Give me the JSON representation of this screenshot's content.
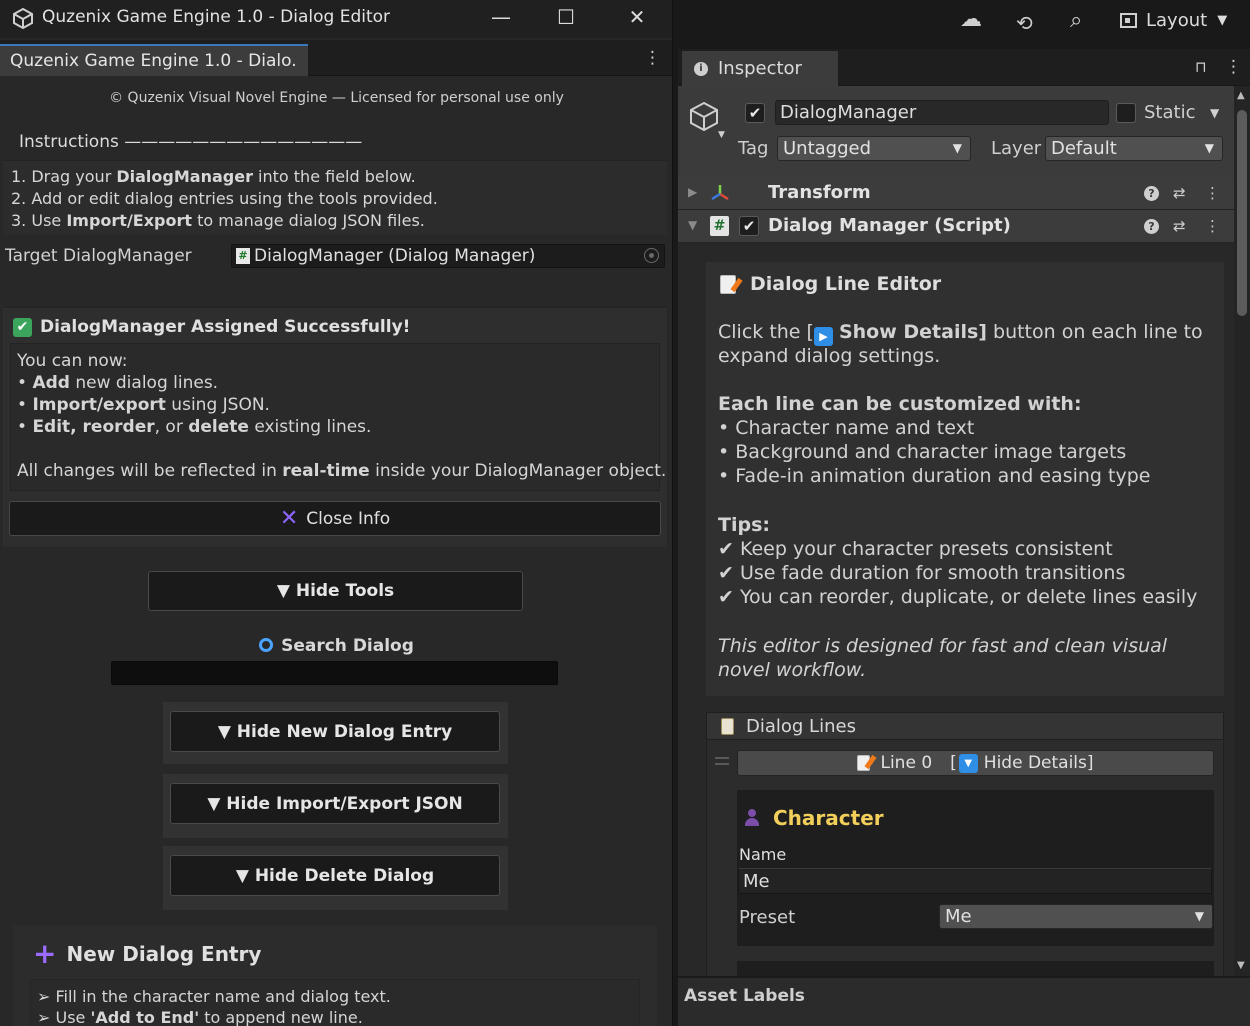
{
  "window": {
    "title": "Quzenix Game Engine 1.0 - Dialog Editor",
    "minimize": "—",
    "maximize": "☐",
    "close": "✕",
    "tab_label": "Quzenix Game Engine 1.0 - Dialo.",
    "tab_menu": "⋮"
  },
  "editor": {
    "copyright": "© Quzenix Visual Novel Engine — Licensed for personal use only",
    "instructions_heading": "Instructions ——————————————",
    "instructions": [
      {
        "pre": "1. Drag your ",
        "bold": "DialogManager",
        "post": " into the field below."
      },
      {
        "pre": "2. Add or edit dialog entries using the tools provided.",
        "bold": "",
        "post": ""
      },
      {
        "pre": "3. Use ",
        "bold": "Import/Export",
        "post": " to manage dialog JSON files."
      }
    ],
    "target_label": "Target DialogManager",
    "target_value": "DialogManager (Dialog Manager)",
    "success_title": "DialogManager Assigned Successfully!",
    "success_intro": "You can now:",
    "success_items": [
      {
        "bold": "Add",
        "post": " new dialog lines."
      },
      {
        "bold": "Import/export",
        "post": " using JSON."
      }
    ],
    "success_item3": {
      "b1": "Edit, reorder",
      "mid": ", or ",
      "b2": "delete",
      "post": " existing lines."
    },
    "success_footer": {
      "pre": "All changes will be reflected in ",
      "bold": "real-time",
      "post": " inside your DialogManager object."
    },
    "close_info_label": "Close Info",
    "hide_tools_label": "▼ Hide Tools",
    "search_label": "Search Dialog",
    "search_value": "",
    "hide_new_entry_label": "▼ Hide New Dialog Entry",
    "hide_import_export_label": "▼ Hide Import/Export JSON",
    "hide_delete_label": "▼ Hide Delete Dialog",
    "new_entry_title": "New Dialog Entry",
    "new_entry_line1": "➢ Fill in the character name and dialog text.",
    "new_entry_line2": {
      "pre": "➢ Use ",
      "bold": "'Add to End'",
      "post": " to append new line."
    }
  },
  "toolbar": {
    "cloud_icon": "☁",
    "history_icon": "⟲",
    "search_icon": "⌕",
    "layout_label": "Layout",
    "layout_caret": "▼"
  },
  "inspector": {
    "tab_label": "Inspector",
    "lock_icon": "🔓",
    "menu_icon": "⋮",
    "object_enabled": true,
    "object_name": "DialogManager",
    "static_label": "Static",
    "tag_label": "Tag",
    "tag_value": "Untagged",
    "layer_label": "Layer",
    "layer_value": "Default",
    "components": [
      {
        "name": "Transform",
        "fold": "▶"
      },
      {
        "name": "Dialog Manager (Script)",
        "fold": "▼"
      }
    ],
    "help": {
      "title": "Dialog Line Editor",
      "click_pre": "Click the [",
      "click_bold": "Show Details]",
      "click_post": " button on each line to",
      "click_line2": "expand dialog settings.",
      "custom_heading": "Each line can be customized with:",
      "custom_items": [
        "• Character name and text",
        "• Background and character image targets",
        "• Fade-in animation duration and easing type"
      ],
      "tips_heading": "Tips:",
      "tips": [
        "✔ Keep your character presets consistent",
        "✔ Use fade duration for smooth transitions",
        "✔ You can reorder, duplicate, or delete lines easily"
      ],
      "footer_line1": "This editor is designed for fast and clean visual",
      "footer_line2": "novel workflow."
    },
    "dialog_lines_label": "Dialog Lines",
    "line0_label": "Line 0",
    "line0_toggle": "Hide Details]",
    "character_title": "Character",
    "name_label": "Name",
    "name_value": "Me",
    "preset_label": "Preset",
    "preset_value": "Me",
    "asset_labels": "Asset Labels"
  }
}
